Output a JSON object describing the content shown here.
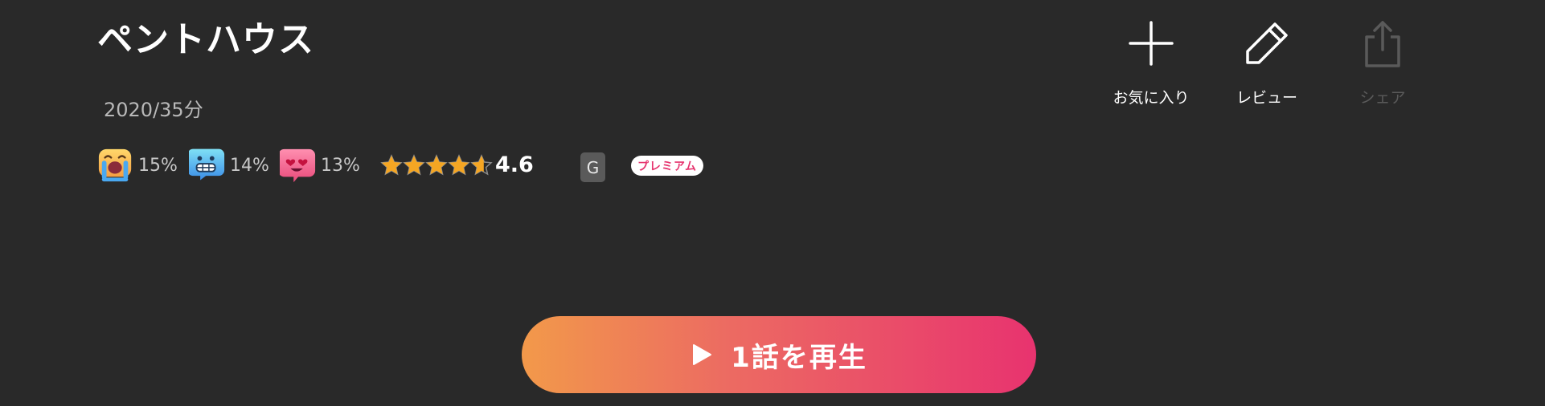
{
  "show": {
    "title": "ペントハウス",
    "meta": "2020/35分"
  },
  "reactions": [
    {
      "icon": "crying-emoji-icon",
      "percent": "15%"
    },
    {
      "icon": "grimacing-emoji-icon",
      "percent": "14%"
    },
    {
      "icon": "heart-eyes-emoji-icon",
      "percent": "13%"
    }
  ],
  "rating": {
    "value": "4.6",
    "stars_filled": 4.6,
    "stars_max": 5
  },
  "badges": {
    "age": "G",
    "premium": "プレミアム"
  },
  "actions": {
    "favorite": {
      "label": "お気に入り",
      "icon": "plus-icon"
    },
    "review": {
      "label": "レビュー",
      "icon": "pencil-icon"
    },
    "share": {
      "label": "シェア",
      "icon": "share-icon",
      "disabled": true
    }
  },
  "play": {
    "label": "1話を再生",
    "icon": "play-icon"
  },
  "colors": {
    "background": "#292929",
    "accent_start": "#f2994a",
    "accent_end": "#e8336f",
    "star": "#f5a623"
  }
}
